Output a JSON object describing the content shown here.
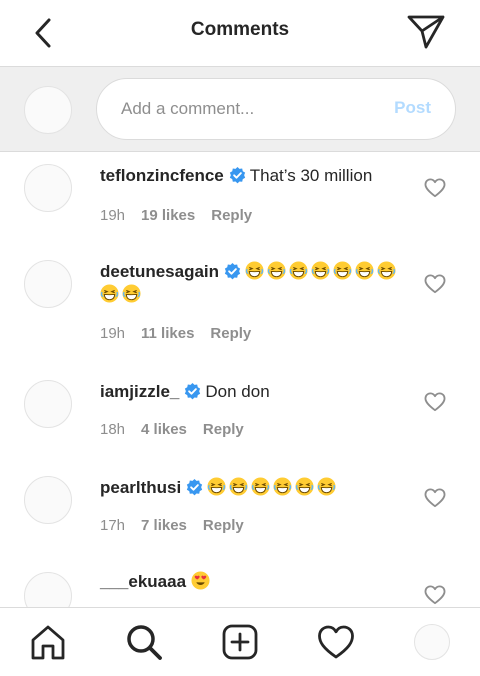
{
  "header": {
    "title": "Comments",
    "back_icon": "chevron-left-icon",
    "send_icon": "paper-plane-icon"
  },
  "composer": {
    "placeholder": "Add a comment...",
    "post_label": "Post"
  },
  "colors": {
    "verified_blue": "#3897f0",
    "meta_gray": "#8e8e8e",
    "post_disabled": "#b3dbff"
  },
  "comments": [
    {
      "username": "teflonzincfence",
      "text": "That’s 30 million",
      "emojis": [],
      "time": "19h",
      "likes": "19 likes",
      "reply": "Reply"
    },
    {
      "username": "deetunesagain",
      "text": "",
      "emojis": [
        "laughing-face-icon",
        "laughing-face-icon",
        "laughing-face-icon",
        "laughing-face-icon",
        "laughing-face-icon",
        "laughing-face-icon",
        "laughing-face-icon",
        "laughing-face-icon",
        "laughing-face-icon"
      ],
      "time": "19h",
      "likes": "11 likes",
      "reply": "Reply"
    },
    {
      "username": "iamjizzle_",
      "text": "Don don",
      "emojis": [],
      "time": "18h",
      "likes": "4 likes",
      "reply": "Reply"
    },
    {
      "username": "pearlthusi",
      "text": "",
      "emojis": [
        "laughing-face-icon",
        "laughing-face-icon",
        "laughing-face-icon",
        "laughing-face-icon",
        "laughing-face-icon",
        "laughing-face-icon"
      ],
      "time": "17h",
      "likes": "7 likes",
      "reply": "Reply"
    },
    {
      "username": "___ekuaaa",
      "text": "",
      "emojis": [
        "heart-eyes-face-icon"
      ],
      "time": "",
      "likes": "",
      "reply": ""
    }
  ],
  "tabbar": {
    "icons": [
      "home-icon",
      "search-icon",
      "new-post-icon",
      "heart-icon",
      "profile-avatar"
    ]
  }
}
